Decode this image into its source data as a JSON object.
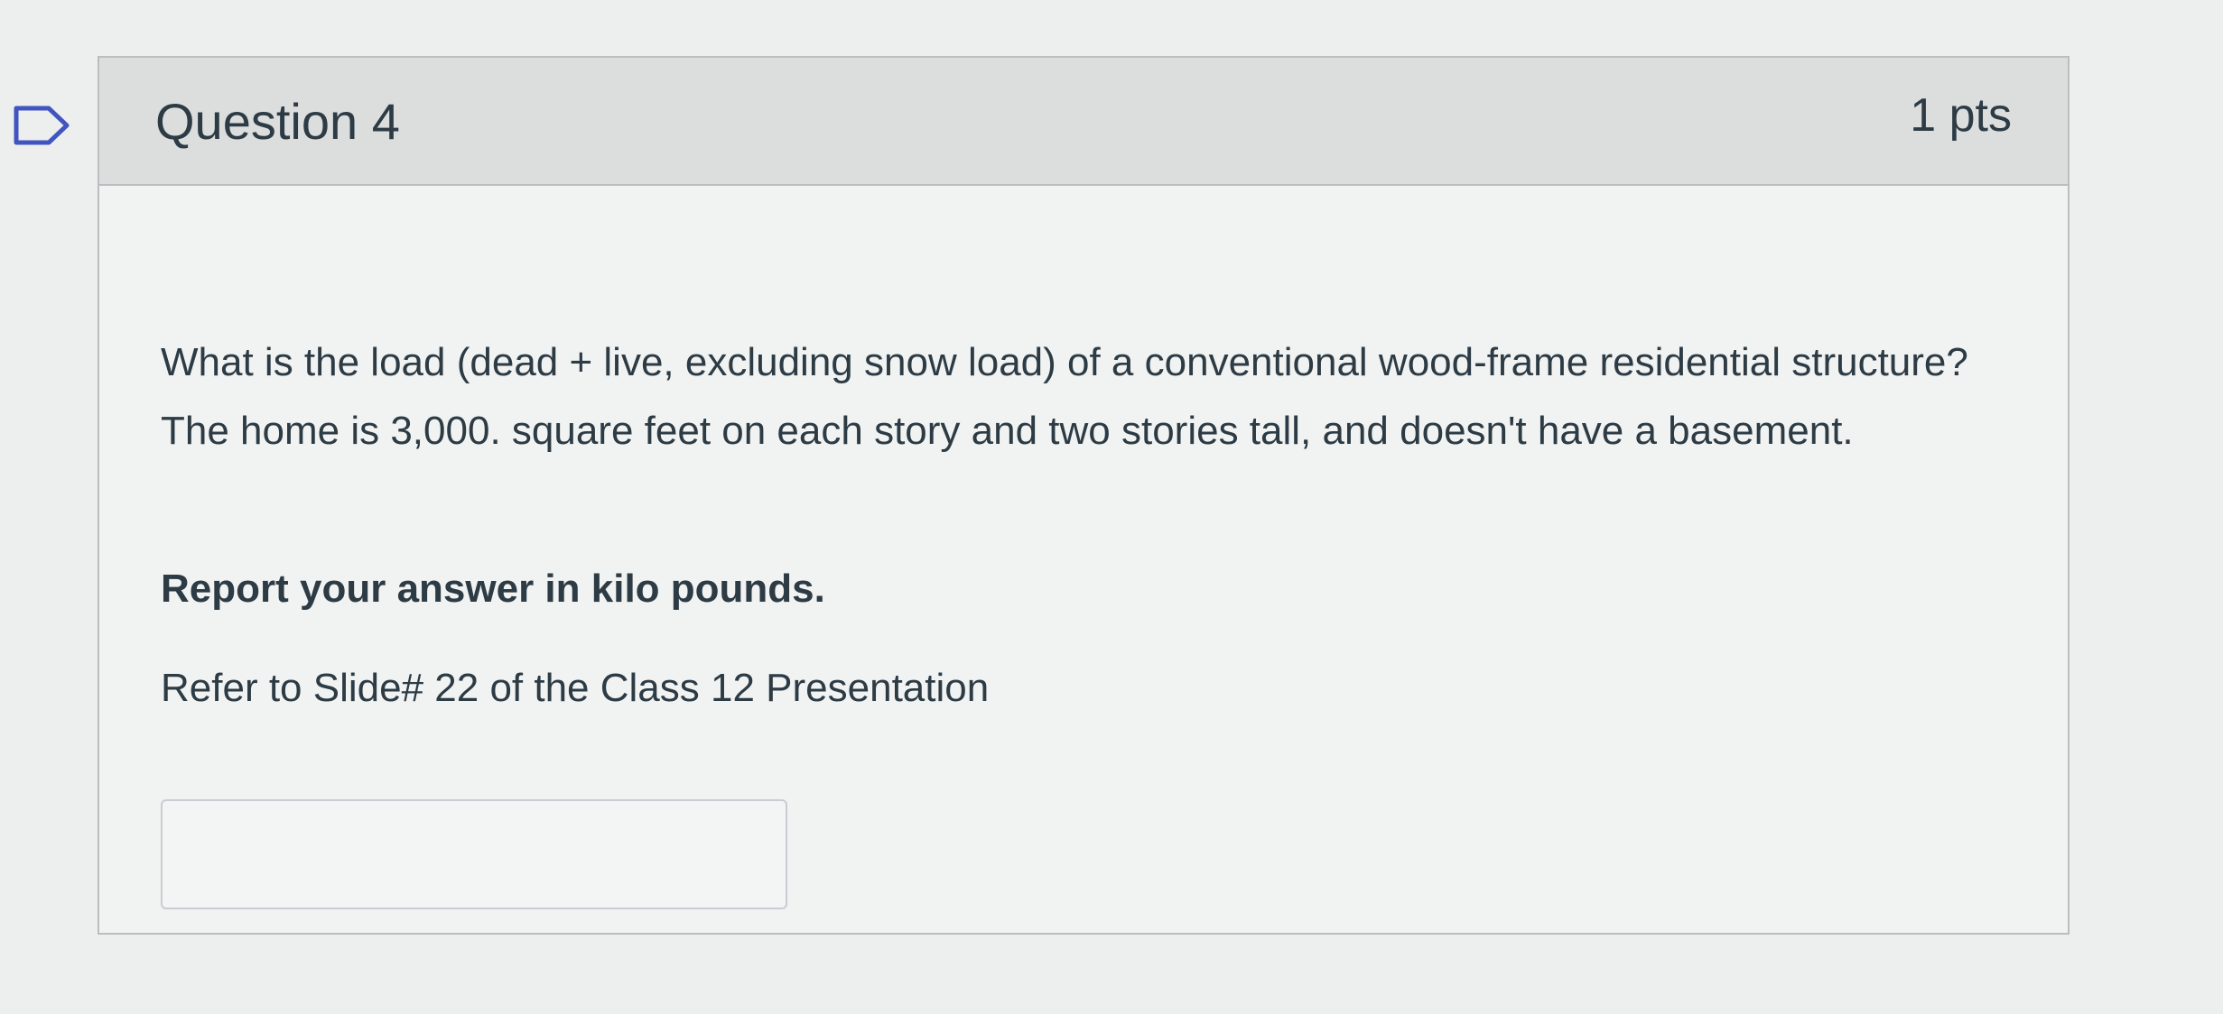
{
  "question": {
    "title": "Question 4",
    "points": "1 pts",
    "text": "What is the load (dead + live, excluding snow load) of a conventional wood-frame residential structure? The home is 3,000. square feet on each story and two stories tall, and doesn't have a basement.",
    "instruction": "Report your answer in kilo pounds.",
    "reference": "Refer to Slide# 22 of the Class 12 Presentation",
    "answer": {
      "value": "",
      "placeholder": ""
    }
  },
  "icons": {
    "flag": "flag-icon"
  },
  "colors": {
    "header_bg": "#dcdedd",
    "body_bg": "#f1f3f2",
    "border": "#b9bec1",
    "text": "#2d3b45",
    "flag_stroke": "#3f51b5"
  }
}
